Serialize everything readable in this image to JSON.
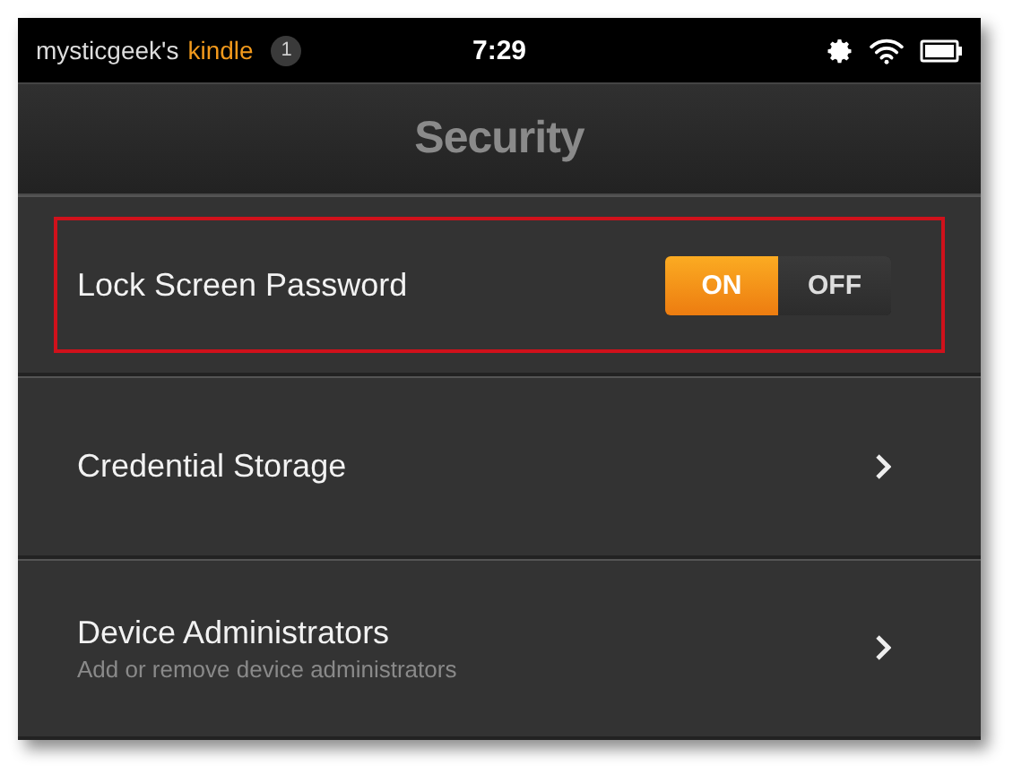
{
  "status_bar": {
    "owner": "mysticgeek's",
    "device": "kindle",
    "notification_count": "1",
    "time": "7:29"
  },
  "title": "Security",
  "rows": [
    {
      "kind": "toggle",
      "label": "Lock Screen Password",
      "highlighted": true,
      "options": [
        {
          "label": "ON",
          "selected": true
        },
        {
          "label": "OFF",
          "selected": false
        }
      ]
    },
    {
      "kind": "link",
      "label": "Credential Storage",
      "highlighted": false
    },
    {
      "kind": "link",
      "label": "Device Administrators",
      "subtitle": "Add or remove device administrators",
      "highlighted": false
    }
  ]
}
